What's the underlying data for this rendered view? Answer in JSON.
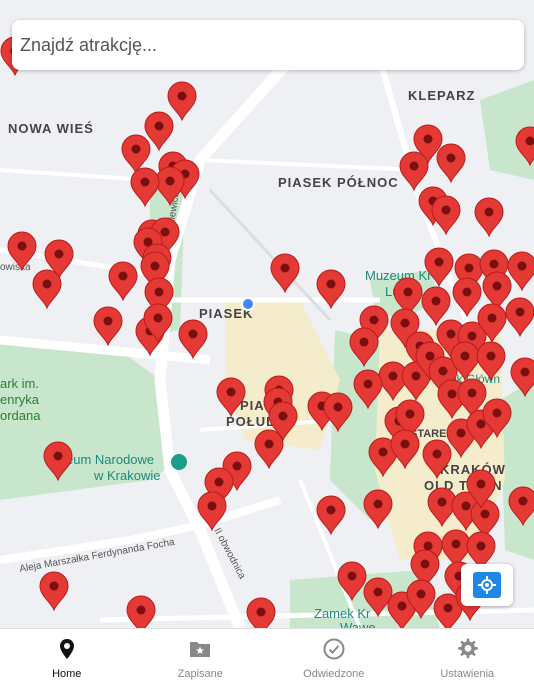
{
  "search": {
    "placeholder": "Znajdź atrakcję..."
  },
  "map": {
    "labels": {
      "nowa_wies": "NOWA WIEŚ",
      "kleparz": "KLEPARZ",
      "piasek_polnoc": "PIASEK PÓŁNOC",
      "piasek": "PIASEK",
      "piasek_poludnie_1": "PIAS",
      "piasek_poludnie_2": "POŁUD",
      "muzeum_krakowa_1": "Muzeum Kr",
      "muzeum_krakowa_2": "Ludo...",
      "park_1": "ark im.",
      "park_2": "enryka",
      "park_3": "ordana",
      "muzeum_narodowe_1": "eum Narodowe",
      "muzeum_narodowe_2": "w Krakowie",
      "krakow_1": "KRAKÓW",
      "krakow_2": "OLD TOWN",
      "stare": "STARE",
      "zamek_1": "Zamek Kr",
      "zamek_2": "Wawe...",
      "focha": "Aleja Marszałka Ferdynanda Focha",
      "obwodnica": "II obwodnica",
      "owiska": "owiska",
      "old_town_side": "ek Główn",
      "al_mick": "Mickiewicza"
    },
    "colors": {
      "pin": "#e53935",
      "pin_stroke": "#b71c1c",
      "park": "#bfe3c6",
      "road": "#ffffff",
      "old_town": "#f5eccb"
    }
  },
  "locate": {
    "icon": "locate-icon"
  },
  "nav": {
    "items": [
      {
        "label": "Home",
        "icon": "map-pin-icon",
        "active": true
      },
      {
        "label": "Zapisane",
        "icon": "folder-star-icon",
        "active": false
      },
      {
        "label": "Odwiedzone",
        "icon": "check-circle-icon",
        "active": false
      },
      {
        "label": "Ustawienia",
        "icon": "gear-icon",
        "active": false
      }
    ]
  }
}
